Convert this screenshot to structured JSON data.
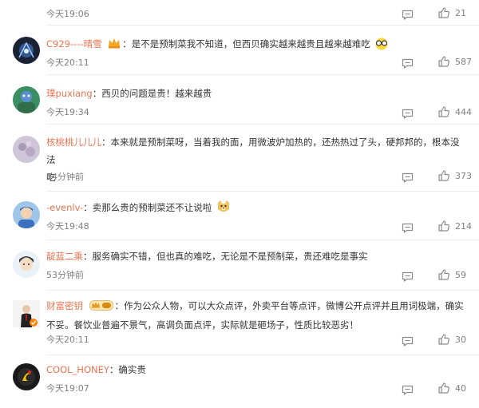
{
  "colors": {
    "username": "#eb7350",
    "text": "#333333",
    "meta": "#7f7f7f",
    "divider": "#eeeeee"
  },
  "comments": [
    {
      "time": "今天19:06",
      "likes": "21"
    },
    {
      "user": "C929----晴雪",
      "colon": "：",
      "text": "是不是预制菜我不知道，但西贝确实越来越贵且越来越难吃",
      "time": "今天20:11",
      "likes": "587",
      "badge": "crown-icon",
      "emoji": "glasses-emoji"
    },
    {
      "user": "璞puxiang",
      "colon": "：",
      "text": "西贝的问题是贵！越来越贵",
      "time": "今天19:34",
      "likes": "444"
    },
    {
      "user": "核桃桃儿儿儿",
      "colon": "：",
      "text": "本来就是预制菜呀，当着我的面，用微波炉加热的，还热热过了头，硬邦邦的，根本没法",
      "text2": "吃",
      "time": "54分钟前",
      "likes": "373"
    },
    {
      "user": "-evenlv-",
      "colon": "：",
      "text": "卖那么贵的预制菜还不让说啦",
      "time": "今天19:48",
      "likes": "214",
      "emoji": "doge-emoji"
    },
    {
      "user": "靛蓝二乘",
      "colon": "：",
      "text": "服务确实不错，但也真的难吃，无论是不是预制菜，贵还难吃是事实",
      "time": "53分钟前",
      "likes": "59"
    },
    {
      "user": "财富密钥",
      "colon": "：",
      "text": "作为公众人物，可以大众点评，外卖平台等点评，微博公开点评并且用词极端，确实",
      "text2": "不妥。餐饮业普遍不景气，高调负面点评，实际就是砸场子，性质比较恶劣！",
      "time": "今天20:11",
      "likes": "30",
      "badge": "vip-badge"
    },
    {
      "user": "COOL_HONEY",
      "colon": "：",
      "text": "确实贵",
      "time": "今天19:07",
      "likes": "40"
    }
  ]
}
